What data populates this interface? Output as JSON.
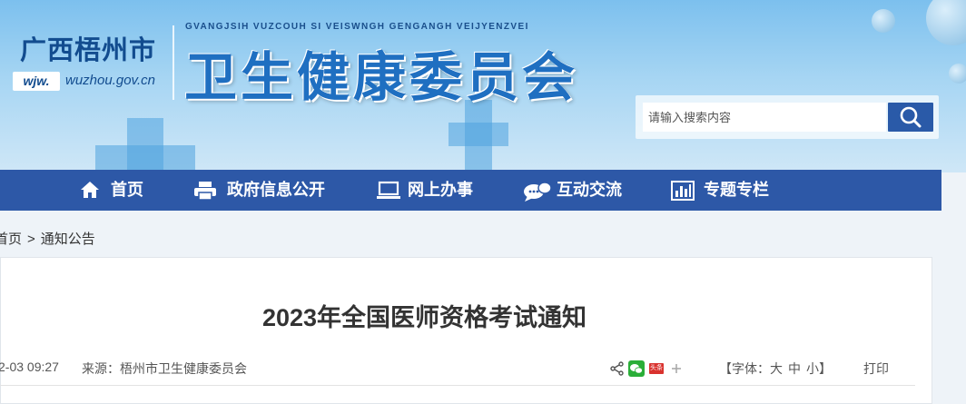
{
  "header": {
    "city_name": "广西梧州市",
    "wjw_tag": "wjw.",
    "domain": "wuzhou.gov.cn",
    "pinyin": "GVANGJSIH VUZCOUH SI VEISWNGH GENGANGH VEIJYENZVEI",
    "org_title": "卫生健康委员会"
  },
  "search": {
    "placeholder": "请输入搜索内容",
    "icon": "search-icon"
  },
  "nav": {
    "items": [
      {
        "label": "首页",
        "icon": "home-icon"
      },
      {
        "label": "政府信息公开",
        "icon": "printer-icon"
      },
      {
        "label": "网上办事",
        "icon": "laptop-icon"
      },
      {
        "label": "互动交流",
        "icon": "chat-bubble-icon"
      },
      {
        "label": "专题专栏",
        "icon": "bar-chart-icon"
      }
    ]
  },
  "breadcrumb": {
    "home": "首页",
    "separator": ">",
    "current": "通知公告"
  },
  "article": {
    "title": "2023年全国医师资格考试通知",
    "date": "2-03 09:27",
    "source": "来源：梧州市卫生健康委员会",
    "font_label": "【字体：",
    "font_large": "大",
    "font_medium": "中",
    "font_small": "小",
    "font_close": "】",
    "print": "打印",
    "share_icons": [
      "share-icon",
      "wechat-icon",
      "toutiao-icon",
      "plus-icon"
    ],
    "toutiao_text": "头条"
  },
  "colors": {
    "nav_bg": "#2d58a7",
    "title_blue": "#1f6fc1",
    "search_btn": "#2a5aa8"
  }
}
